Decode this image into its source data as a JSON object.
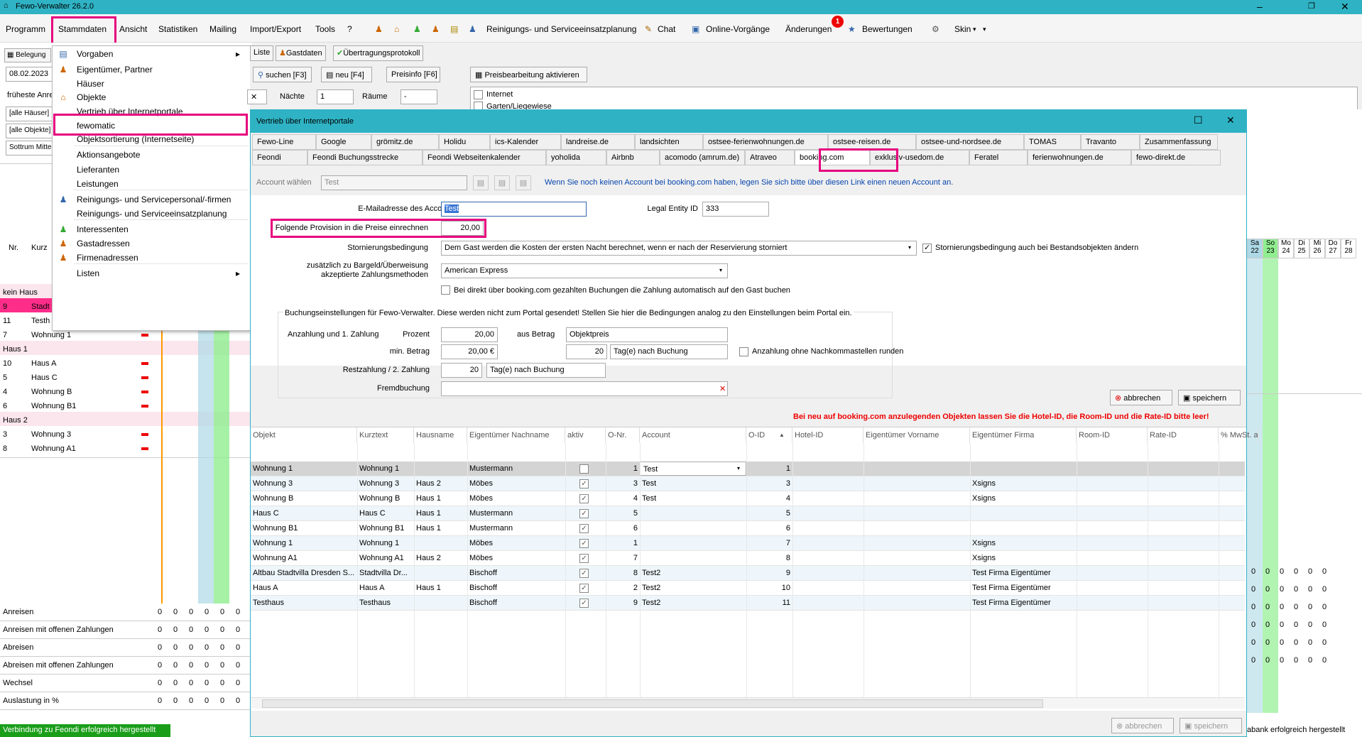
{
  "app": {
    "title": "Fewo-Verwalter 26.2.0"
  },
  "menu": [
    "Programm",
    "Stammdaten",
    "Ansicht",
    "Statistiken",
    "Mailing",
    "Import/Export",
    "Tools",
    "?",
    "Reinigungs- und Serviceeinsatzplanung",
    "Chat",
    "Online-Vorgänge",
    "Änderungen",
    "Bewertungen",
    "Skin"
  ],
  "badge": "1",
  "dropdown": [
    {
      "label": "Vorgaben",
      "arrow": "▸"
    },
    {
      "label": "Eigentümer, Partner"
    },
    {
      "label": "Häuser"
    },
    {
      "label": "Objekte"
    },
    {
      "label": "Vertrieb über Internetportale"
    },
    {
      "label": "fewomatic"
    },
    {
      "label": "Objektsortierung (Internetseite)"
    },
    {
      "label": "Aktionsangebote"
    },
    {
      "label": "Lieferanten"
    },
    {
      "label": "Leistungen"
    },
    {
      "label": "Reinigungs- und Servicepersonal/-firmen"
    },
    {
      "label": "Reinigungs- und Serviceeinsatzplanung"
    },
    {
      "label": "Interessenten"
    },
    {
      "label": "Gastadressen"
    },
    {
      "label": "Firmenadressen"
    },
    {
      "label": "Listen",
      "arrow": "▸"
    }
  ],
  "toolbar": {
    "belegung": "Belegung",
    "liste": "Liste",
    "gastdaten": "Gastdaten",
    "protokoll": "Übertragungsprotokoll",
    "suchen": "suchen [F3]",
    "neu": "neu [F4]",
    "preisinfo": "Preisinfo [F6]",
    "preisbearb": "Preisbearbeitung aktivieren"
  },
  "filters": {
    "date": "08.02.2023",
    "frueheste": "früheste Anrei",
    "haeuser": "[alle Häuser]",
    "objekte": "[alle Objekte]",
    "ort": "Sottrum Mitte",
    "naechte_label": "Nächte",
    "naechte": "1",
    "raeume_label": "Räume",
    "raeume": "-",
    "internet": "Internet",
    "garten": "Garten/Liegewiese"
  },
  "left": {
    "cols": [
      "Nr.",
      "Kurz"
    ],
    "rows": [
      {
        "nr": "",
        "kurz": "kein Haus",
        "group": true
      },
      {
        "nr": "9",
        "kurz": "Stadt",
        "pink": true
      },
      {
        "nr": "11",
        "kurz": "Testh"
      },
      {
        "nr": "7",
        "kurz": "Wohnung 1"
      },
      {
        "nr": "",
        "kurz": "Haus 1",
        "group": true
      },
      {
        "nr": "10",
        "kurz": "Haus A"
      },
      {
        "nr": "5",
        "kurz": "Haus C"
      },
      {
        "nr": "4",
        "kurz": "Wohnung B"
      },
      {
        "nr": "6",
        "kurz": "Wohnung B1"
      },
      {
        "nr": "",
        "kurz": "Haus 2",
        "group": true
      },
      {
        "nr": "3",
        "kurz": "Wohnung 3"
      },
      {
        "nr": "8",
        "kurz": "Wohnung A1"
      }
    ],
    "summary": [
      "Anreisen",
      "Anreisen mit offenen Zahlungen",
      "Abreisen",
      "Abreisen mit offenen Zahlungen",
      "Wechsel",
      "Auslastung in %"
    ],
    "zero": "0"
  },
  "calendar": {
    "days": [
      "Sa",
      "So",
      "Mo",
      "Di",
      "Mi",
      "Do",
      "Fr"
    ],
    "dates": [
      "22",
      "23",
      "24",
      "25",
      "26",
      "27",
      "28"
    ]
  },
  "dialog": {
    "title": "Vertrieb über Internetportale",
    "tabs1": [
      "Fewo-Line",
      "Google",
      "grömitz.de",
      "Holidu",
      "ics-Kalender",
      "landreise.de",
      "landsichten",
      "ostsee-ferienwohnungen.de",
      "ostsee-reisen.de",
      "ostsee-und-nordsee.de",
      "TOMAS",
      "Travanto",
      "Zusammenfassung"
    ],
    "tabs2": [
      "Feondi",
      "Feondi Buchungsstrecke",
      "Feondi Webseitenkalender",
      "yoholida",
      "Airbnb",
      "acomodo (amrum.de)",
      "Atraveo",
      "booking.com",
      "exklusiv-usedom.de",
      "Feratel",
      "ferienwohnungen.de",
      "fewo-direkt.de"
    ],
    "account_label": "Account wählen",
    "account": "Test",
    "hint": "Wenn Sie noch keinen Account bei booking.com haben, legen Sie sich bitte über diesen Link einen neuen Account an.",
    "email_label": "E-Mailadresse des Accounts",
    "email": "Test",
    "legal_label": "Legal Entity ID",
    "legal": "333",
    "prov_label": "Folgende Provision in die Preise einrechnen",
    "prov": "20,00",
    "storno_label": "Stornierungsbedingung",
    "storno": "Dem Gast werden die Kosten der ersten Nacht berechnet, wenn er nach der Reservierung storniert",
    "storno_chk": "Stornierungsbedingung auch bei Bestandsobjekten ändern",
    "zahl_label1": "zusätzlich zu Bargeld/Überweisung",
    "zahl_label2": "akzeptierte Zahlungsmethoden",
    "zahl": "American Express",
    "auto_chk": "Bei direkt über booking.com gezahlten Buchungen die Zahlung automatisch auf den Gast buchen",
    "group_title": "Buchungseinstellungen für Fewo-Verwalter. Diese werden nicht zum Portal gesendet! Stellen Sie hier die Bedingungen analog zu den Einstellungen beim Portal ein.",
    "anz_label": "Anzahlung und 1. Zahlung",
    "prozent_label": "Prozent",
    "prozent": "20,00",
    "aus_label": "aus Betrag",
    "aus": "Objektpreis",
    "minb_label": "min. Betrag",
    "minb": "20,00 €",
    "tage1": "20",
    "tage1_unit": "Tag(e) nach Buchung",
    "runden": "Anzahlung ohne Nachkommastellen runden",
    "rest_label": "Restzahlung / 2. Zahlung",
    "tage2": "20",
    "tage2_unit": "Tag(e) nach Buchung",
    "fremd_label": "Fremdbuchung",
    "fremd": "",
    "abbrechen": "abbrechen",
    "speichern": "speichern",
    "warn": "Bei neu auf booking.com anzulegenden Objekten lassen Sie die Hotel-ID, die Room-ID und die Rate-ID bitte leer!",
    "cols": [
      "Objekt",
      "Kurztext",
      "Hausname",
      "Eigentümer Nachname",
      "aktiv",
      "O-Nr.",
      "Account",
      "O-ID",
      "Hotel-ID",
      "Eigentümer Vorname",
      "Eigentümer Firma",
      "Room-ID",
      "Rate-ID",
      "% MwSt. a"
    ],
    "rows": [
      [
        "Wohnung 1",
        "Wohnung 1",
        "",
        "Mustermann",
        false,
        "1",
        "Test",
        "1",
        "",
        "",
        "",
        "",
        ""
      ],
      [
        "Wohnung 3",
        "Wohnung 3",
        "Haus 2",
        "Möbes",
        true,
        "3",
        "Test",
        "3",
        "",
        "",
        "Xsigns",
        "",
        ""
      ],
      [
        "Wohnung B",
        "Wohnung B",
        "Haus 1",
        "Möbes",
        true,
        "4",
        "Test",
        "4",
        "",
        "",
        "Xsigns",
        "",
        ""
      ],
      [
        "Haus C",
        "Haus C",
        "Haus 1",
        "Mustermann",
        true,
        "5",
        "",
        "5",
        "",
        "",
        "",
        "",
        ""
      ],
      [
        "Wohnung B1",
        "Wohnung B1",
        "Haus 1",
        "Mustermann",
        true,
        "6",
        "",
        "6",
        "",
        "",
        "",
        "",
        ""
      ],
      [
        "Wohnung 1",
        "Wohnung 1",
        "",
        "Möbes",
        true,
        "1",
        "",
        "7",
        "",
        "",
        "Xsigns",
        "",
        ""
      ],
      [
        "Wohnung A1",
        "Wohnung A1",
        "Haus 2",
        "Möbes",
        true,
        "7",
        "",
        "8",
        "",
        "",
        "Xsigns",
        "",
        ""
      ],
      [
        "Altbau Stadtvilla Dresden S...",
        "Stadtvilla Dr...",
        "",
        "Bischoff",
        true,
        "8",
        "Test2",
        "9",
        "",
        "",
        "Test Firma Eigentümer",
        "",
        ""
      ],
      [
        "Haus A",
        "Haus A",
        "Haus 1",
        "Bischoff",
        true,
        "2",
        "Test2",
        "10",
        "",
        "",
        "Test Firma Eigentümer",
        "",
        ""
      ],
      [
        "Testhaus",
        "Testhaus",
        "",
        "Bischoff",
        true,
        "9",
        "Test2",
        "11",
        "",
        "",
        "Test Firma Eigentümer",
        "",
        ""
      ]
    ]
  },
  "status": {
    "left": "Verbindung zu Feondi erfolgreich hergestellt",
    "right": "abank erfolgreich hergestellt"
  },
  "colors": {
    "accent": "#2fb3c4",
    "highlight": "#e6007e",
    "warn": "#e00000"
  }
}
